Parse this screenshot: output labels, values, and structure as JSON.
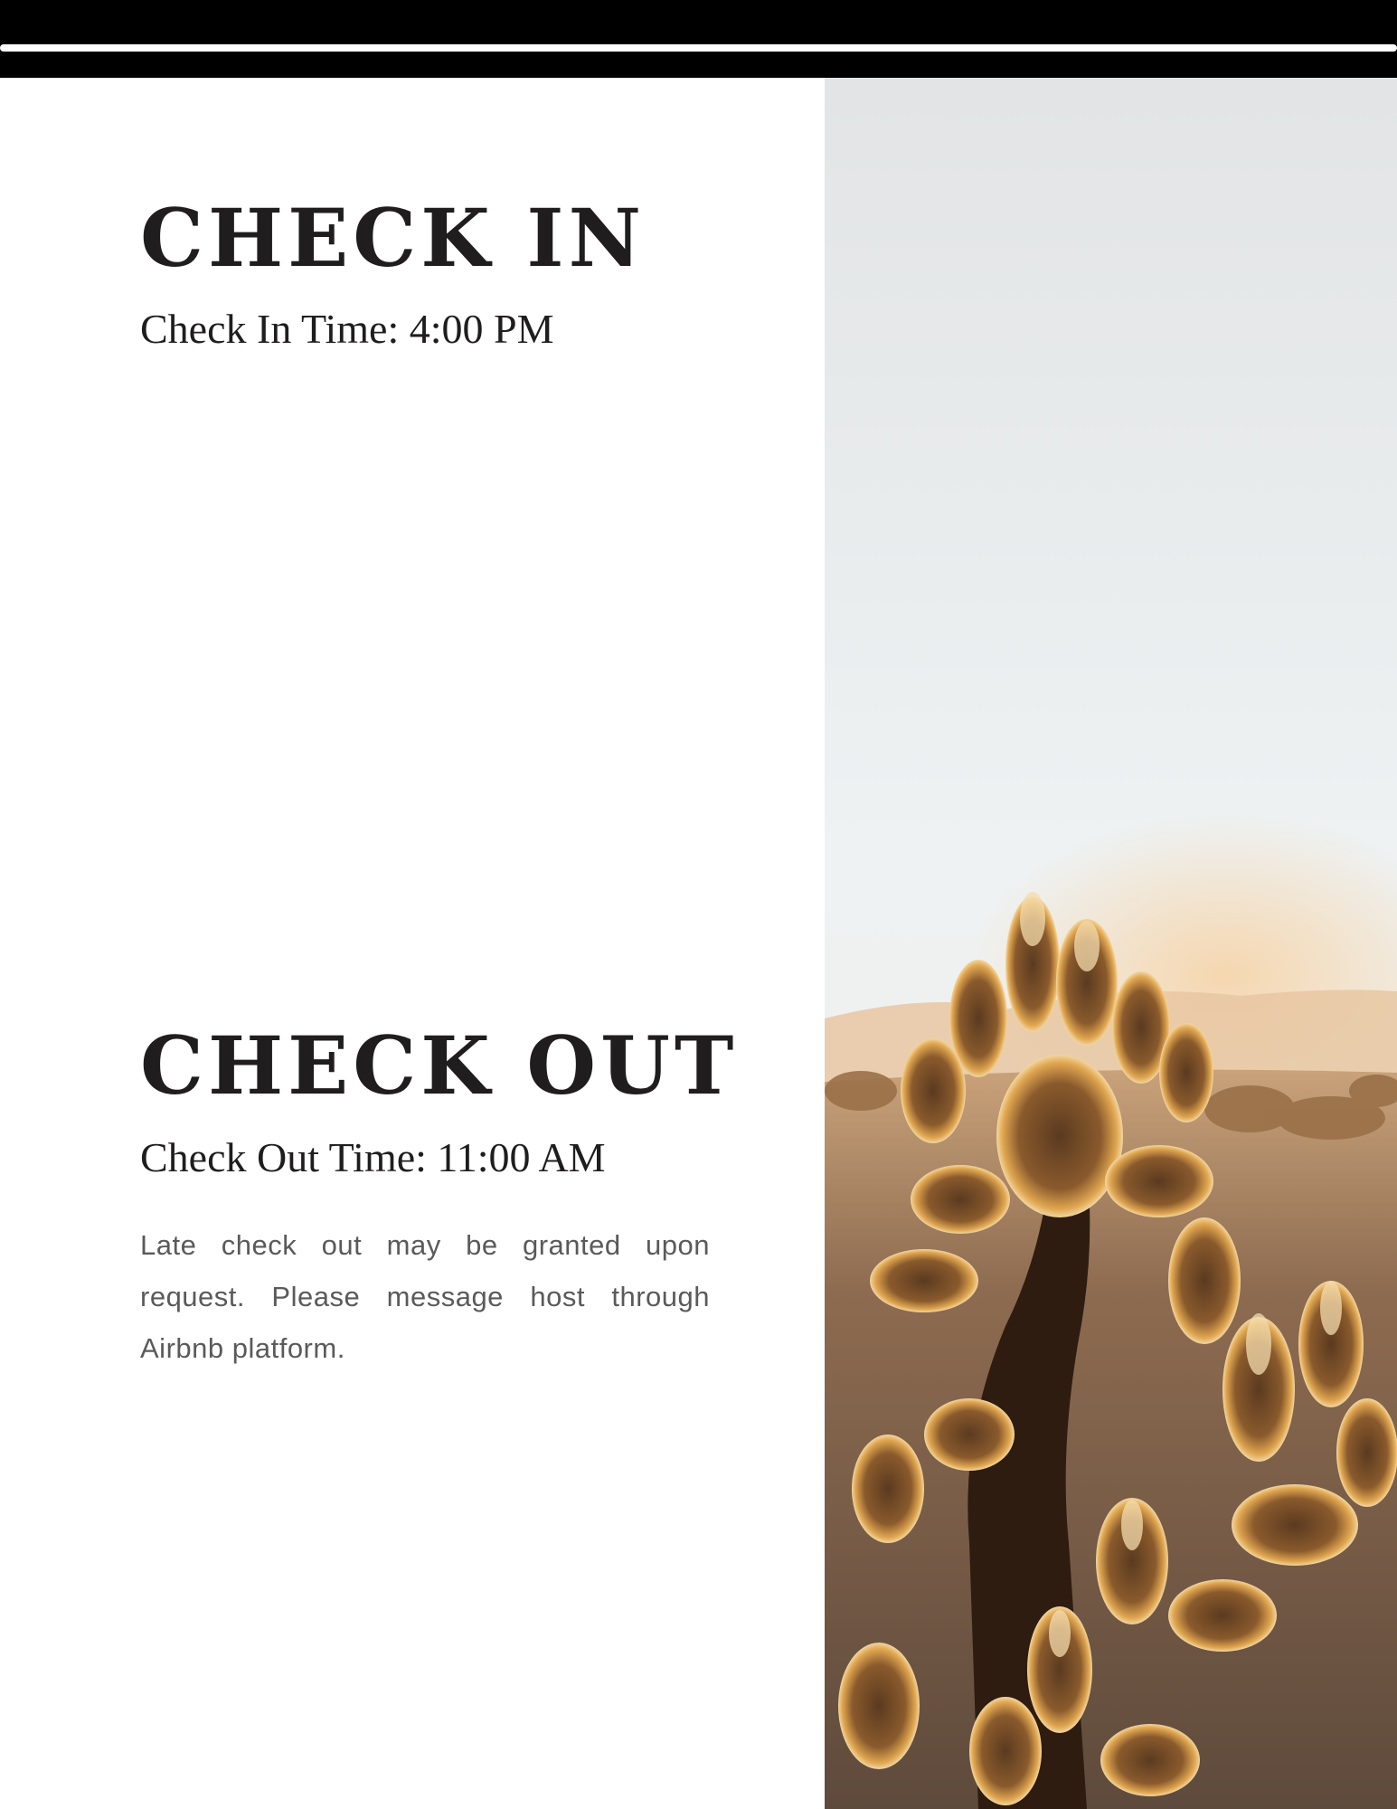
{
  "check_in": {
    "heading": "CHECK IN",
    "time_line": "Check In Time: 4:00 PM"
  },
  "check_out": {
    "heading": "CHECK OUT",
    "time_line": "Check Out Time: 11:00 AM",
    "note": "Late check out may be granted upon request. Please message host through Airbnb platform."
  },
  "colors": {
    "heading": "#1f1d1e",
    "body_text": "#5a5a5a",
    "top_band": "#000000",
    "sky": "#e6ecee",
    "cactus_glow": "#d9a45a",
    "cactus_dark": "#3a2413"
  }
}
